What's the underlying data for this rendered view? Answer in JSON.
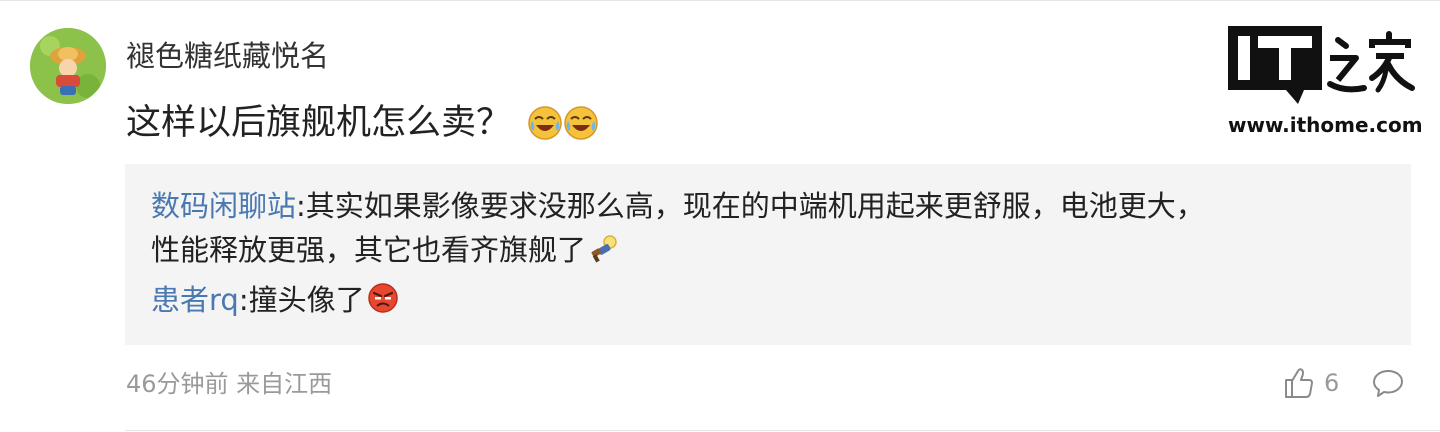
{
  "comment": {
    "username": "褪色糖纸藏悦名",
    "text": "这样以后旗舰机怎么卖？",
    "emojis": [
      "crying-laughing-icon",
      "crying-laughing-icon"
    ],
    "meta": "46分钟前 来自江西",
    "likes": "6"
  },
  "quoted_replies": [
    {
      "user": "数码闲聊站",
      "text_line1": ":其实如果影像要求没那么高，现在的中端机用起来更舒服，电池更大，",
      "text_line2": "性能释放更强，其它也看齐旗舰了",
      "emoji": "gun-thumbs-up-icon"
    },
    {
      "user": "患者rq",
      "text": ":撞头像了",
      "emoji": "angry-face-icon"
    }
  ],
  "logo": {
    "url": "www.ithome.com",
    "brand": "IT之家"
  },
  "colors": {
    "quote_user": "#4a78b0",
    "meta_gray": "#9a9a9a",
    "quote_bg": "#f4f4f4"
  }
}
